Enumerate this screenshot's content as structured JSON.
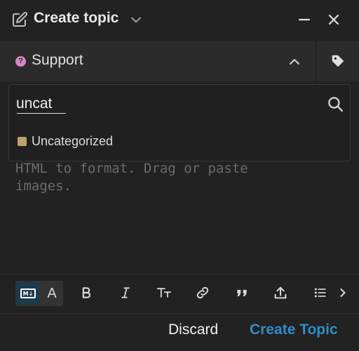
{
  "header": {
    "title": "Create topic",
    "icons": [
      "edit-icon",
      "chevron-down-icon",
      "minimize-icon",
      "close-icon"
    ]
  },
  "category": {
    "label": "Support",
    "badge_symbol": "?",
    "badge_color": "#d586c8",
    "icons": [
      "chevron-up-icon",
      "tag-icon"
    ]
  },
  "search": {
    "value": "uncat",
    "icon": "search-icon"
  },
  "results": [
    {
      "label": "Uncategorized",
      "color": "#bfa06a"
    }
  ],
  "editor": {
    "placeholder": "HTML to format. Drag or paste\nimages."
  },
  "toolbar": {
    "markdown_badge": "M↓",
    "font_toggle": "A",
    "buttons": [
      "bold-icon",
      "italic-icon",
      "text-size-icon",
      "link-icon",
      "quote-icon",
      "upload-icon",
      "list-icon",
      "chevron-right-icon"
    ]
  },
  "footer": {
    "discard_label": "Discard",
    "create_label": "Create Topic",
    "accent": "#2f8ec7"
  }
}
